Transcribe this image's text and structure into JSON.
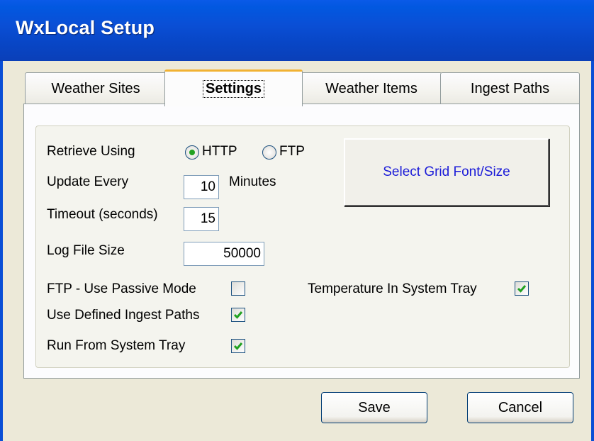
{
  "window": {
    "title": "WxLocal Setup"
  },
  "tabs": [
    {
      "label": "Weather Sites"
    },
    {
      "label": "Settings",
      "active": true
    },
    {
      "label": "Weather Items"
    },
    {
      "label": "Ingest Paths"
    }
  ],
  "settings": {
    "retrieve_label": "Retrieve Using",
    "radio_http": "HTTP",
    "radio_ftp": "FTP",
    "retrieve_selected": "HTTP",
    "update_label": "Update Every",
    "update_value": "10",
    "update_unit": "Minutes",
    "timeout_label": "Timeout (seconds)",
    "timeout_value": "15",
    "logsize_label": "Log File Size",
    "logsize_value": "50000",
    "ftp_passive_label": "FTP - Use Passive Mode",
    "ftp_passive_checked": false,
    "ingest_label": "Use Defined Ingest Paths",
    "ingest_checked": true,
    "tray_label": "Run From System Tray",
    "tray_checked": true,
    "temp_tray_label": "Temperature In System Tray",
    "temp_tray_checked": true,
    "font_button": "Select Grid Font/Size"
  },
  "buttons": {
    "save": "Save",
    "cancel": "Cancel"
  },
  "colors": {
    "title_bar": "#0a4fd6",
    "active_tab_accent": "#f1b233",
    "link_text": "#1b1bd8",
    "check": "#21a121"
  }
}
